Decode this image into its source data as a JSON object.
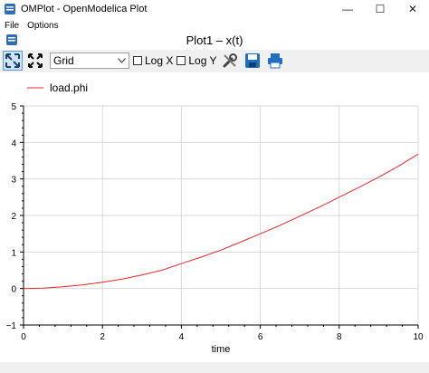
{
  "window": {
    "title": "OMPlot - OpenModelica Plot",
    "minimize": "—",
    "maximize": "☐",
    "close": "✕"
  },
  "menu": {
    "file": "File",
    "options": "Options"
  },
  "plot_window": {
    "title": "Plot1 – x(t)"
  },
  "toolbar": {
    "grid_select_value": "Grid",
    "log_x_label": "Log X",
    "log_y_label": "Log Y",
    "log_x_checked": false,
    "log_y_checked": false
  },
  "colors": {
    "series": "#e8282b",
    "accent": "#1f6fbf"
  },
  "chart_data": {
    "type": "line",
    "title": "",
    "xlabel": "time",
    "ylabel": "",
    "xlim": [
      0,
      10
    ],
    "ylim": [
      -1,
      5
    ],
    "xticks": [
      "0",
      "2",
      "4",
      "6",
      "8",
      "10"
    ],
    "yticks": [
      "−1",
      "0",
      "1",
      "2",
      "3",
      "4",
      "5"
    ],
    "grid": true,
    "legend_position": "top-left",
    "series": [
      {
        "name": "load.phi",
        "x": [
          0,
          0.5,
          1,
          1.5,
          2,
          2.5,
          3,
          3.5,
          4,
          4.5,
          5,
          5.5,
          6,
          6.5,
          7,
          7.5,
          8,
          8.5,
          9,
          9.5,
          10
        ],
        "y": [
          0,
          0.01,
          0.05,
          0.1,
          0.17,
          0.26,
          0.37,
          0.5,
          0.68,
          0.86,
          1.05,
          1.27,
          1.5,
          1.73,
          1.98,
          2.23,
          2.5,
          2.77,
          3.05,
          3.35,
          3.68
        ]
      }
    ]
  }
}
